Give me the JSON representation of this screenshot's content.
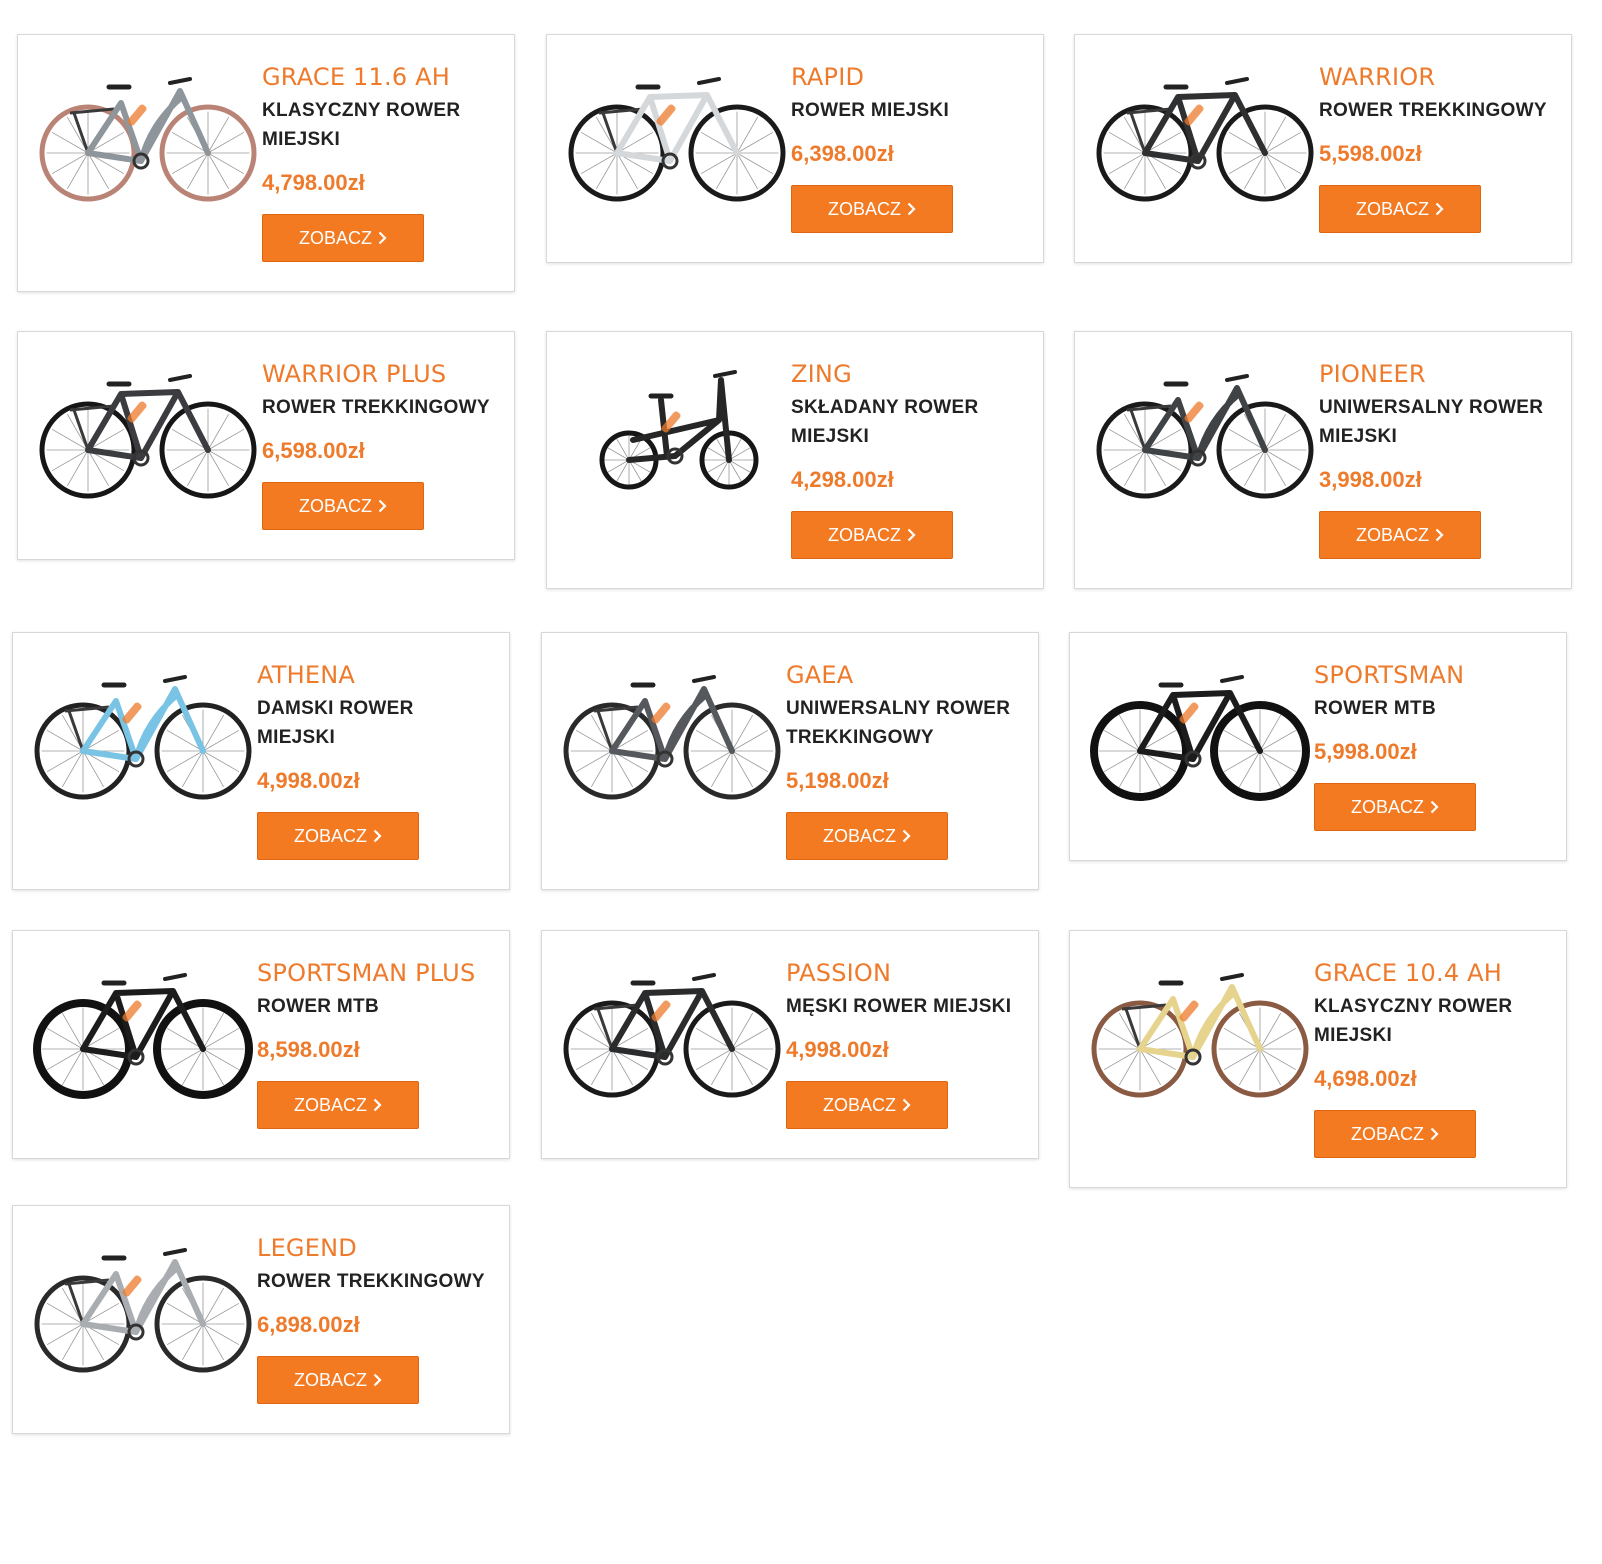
{
  "products": [
    {
      "name": "GRACE 11.6 AH",
      "type": "KLASYCZNY ROWER MIEJSKI",
      "price": "4,798.00zł",
      "button": "ZOBACZ",
      "icon": "bike-city-grey-icon",
      "frame": "#8e969b",
      "tire": "#b98475",
      "style": "step"
    },
    {
      "name": "RAPID",
      "type": "ROWER MIEJSKI",
      "price": "6,398.00zł",
      "button": "ZOBACZ",
      "icon": "bike-city-white-icon",
      "frame": "#d5d8da",
      "tire": "#1a1a1a",
      "style": "diamond"
    },
    {
      "name": "WARRIOR",
      "type": "ROWER TREKKINGOWY",
      "price": "5,598.00zł",
      "button": "ZOBACZ",
      "icon": "bike-trekking-icon",
      "frame": "#2f3032",
      "tire": "#1a1a1a",
      "style": "diamond"
    },
    {
      "name": "WARRIOR PLUS",
      "type": "ROWER TREKKINGOWY",
      "price": "6,598.00zł",
      "button": "ZOBACZ",
      "icon": "bike-trekking-icon",
      "frame": "#3a3c3f",
      "tire": "#161616",
      "style": "diamond"
    },
    {
      "name": "ZING",
      "type": "SKŁADANY ROWER MIEJSKI",
      "price": "4,298.00zł",
      "button": "ZOBACZ",
      "icon": "bike-folding-icon",
      "frame": "#262626",
      "tire": "#161616",
      "style": "folding"
    },
    {
      "name": "PIONEER",
      "type": "UNIWERSALNY ROWER MIEJSKI",
      "price": "3,998.00zł",
      "button": "ZOBACZ",
      "icon": "bike-city-dark-icon",
      "frame": "#404346",
      "tire": "#1a1a1a",
      "style": "step"
    },
    {
      "name": "ATHENA",
      "type": "DAMSKI ROWER MIEJSKI",
      "price": "4,998.00zł",
      "button": "ZOBACZ",
      "icon": "bike-ladies-icon",
      "frame": "#79c3e5",
      "tire": "#222222",
      "style": "step"
    },
    {
      "name": "GAEA",
      "type": "UNIWERSALNY ROWER TREKKINGOWY",
      "price": "5,198.00zł",
      "button": "ZOBACZ",
      "icon": "bike-trekking-icon",
      "frame": "#55585c",
      "tire": "#2a2a2a",
      "style": "step"
    },
    {
      "name": "SPORTSMAN",
      "type": "ROWER MTB",
      "price": "5,998.00zł",
      "button": "ZOBACZ",
      "icon": "bike-mtb-icon",
      "frame": "#1c1c1c",
      "tire": "#111111",
      "style": "mtb"
    },
    {
      "name": "SPORTSMAN PLUS",
      "type": "ROWER MTB",
      "price": "8,598.00zł",
      "button": "ZOBACZ",
      "icon": "bike-mtb-icon",
      "frame": "#1c1c1c",
      "tire": "#111111",
      "style": "mtb"
    },
    {
      "name": "PASSION",
      "type": "MĘSKI ROWER MIEJSKI",
      "price": "4,998.00zł",
      "button": "ZOBACZ",
      "icon": "bike-city-dark-icon",
      "frame": "#2a2b2d",
      "tire": "#1a1a1a",
      "style": "diamond"
    },
    {
      "name": "GRACE 10.4 AH",
      "type": "KLASYCZNY ROWER MIEJSKI",
      "price": "4,698.00zł",
      "button": "ZOBACZ",
      "icon": "bike-city-cream-icon",
      "frame": "#e6d48e",
      "tire": "#8a5a43",
      "style": "step"
    },
    {
      "name": "LEGEND",
      "type": "ROWER TREKKINGOWY",
      "price": "6,898.00zł",
      "button": "ZOBACZ",
      "icon": "bike-trekking-silver-icon",
      "frame": "#a9adb1",
      "tire": "#2a2a2a",
      "style": "step"
    }
  ],
  "colors": {
    "accent": "#f47a22",
    "name": "#ee7a2b",
    "border": "#d8d8d8"
  }
}
